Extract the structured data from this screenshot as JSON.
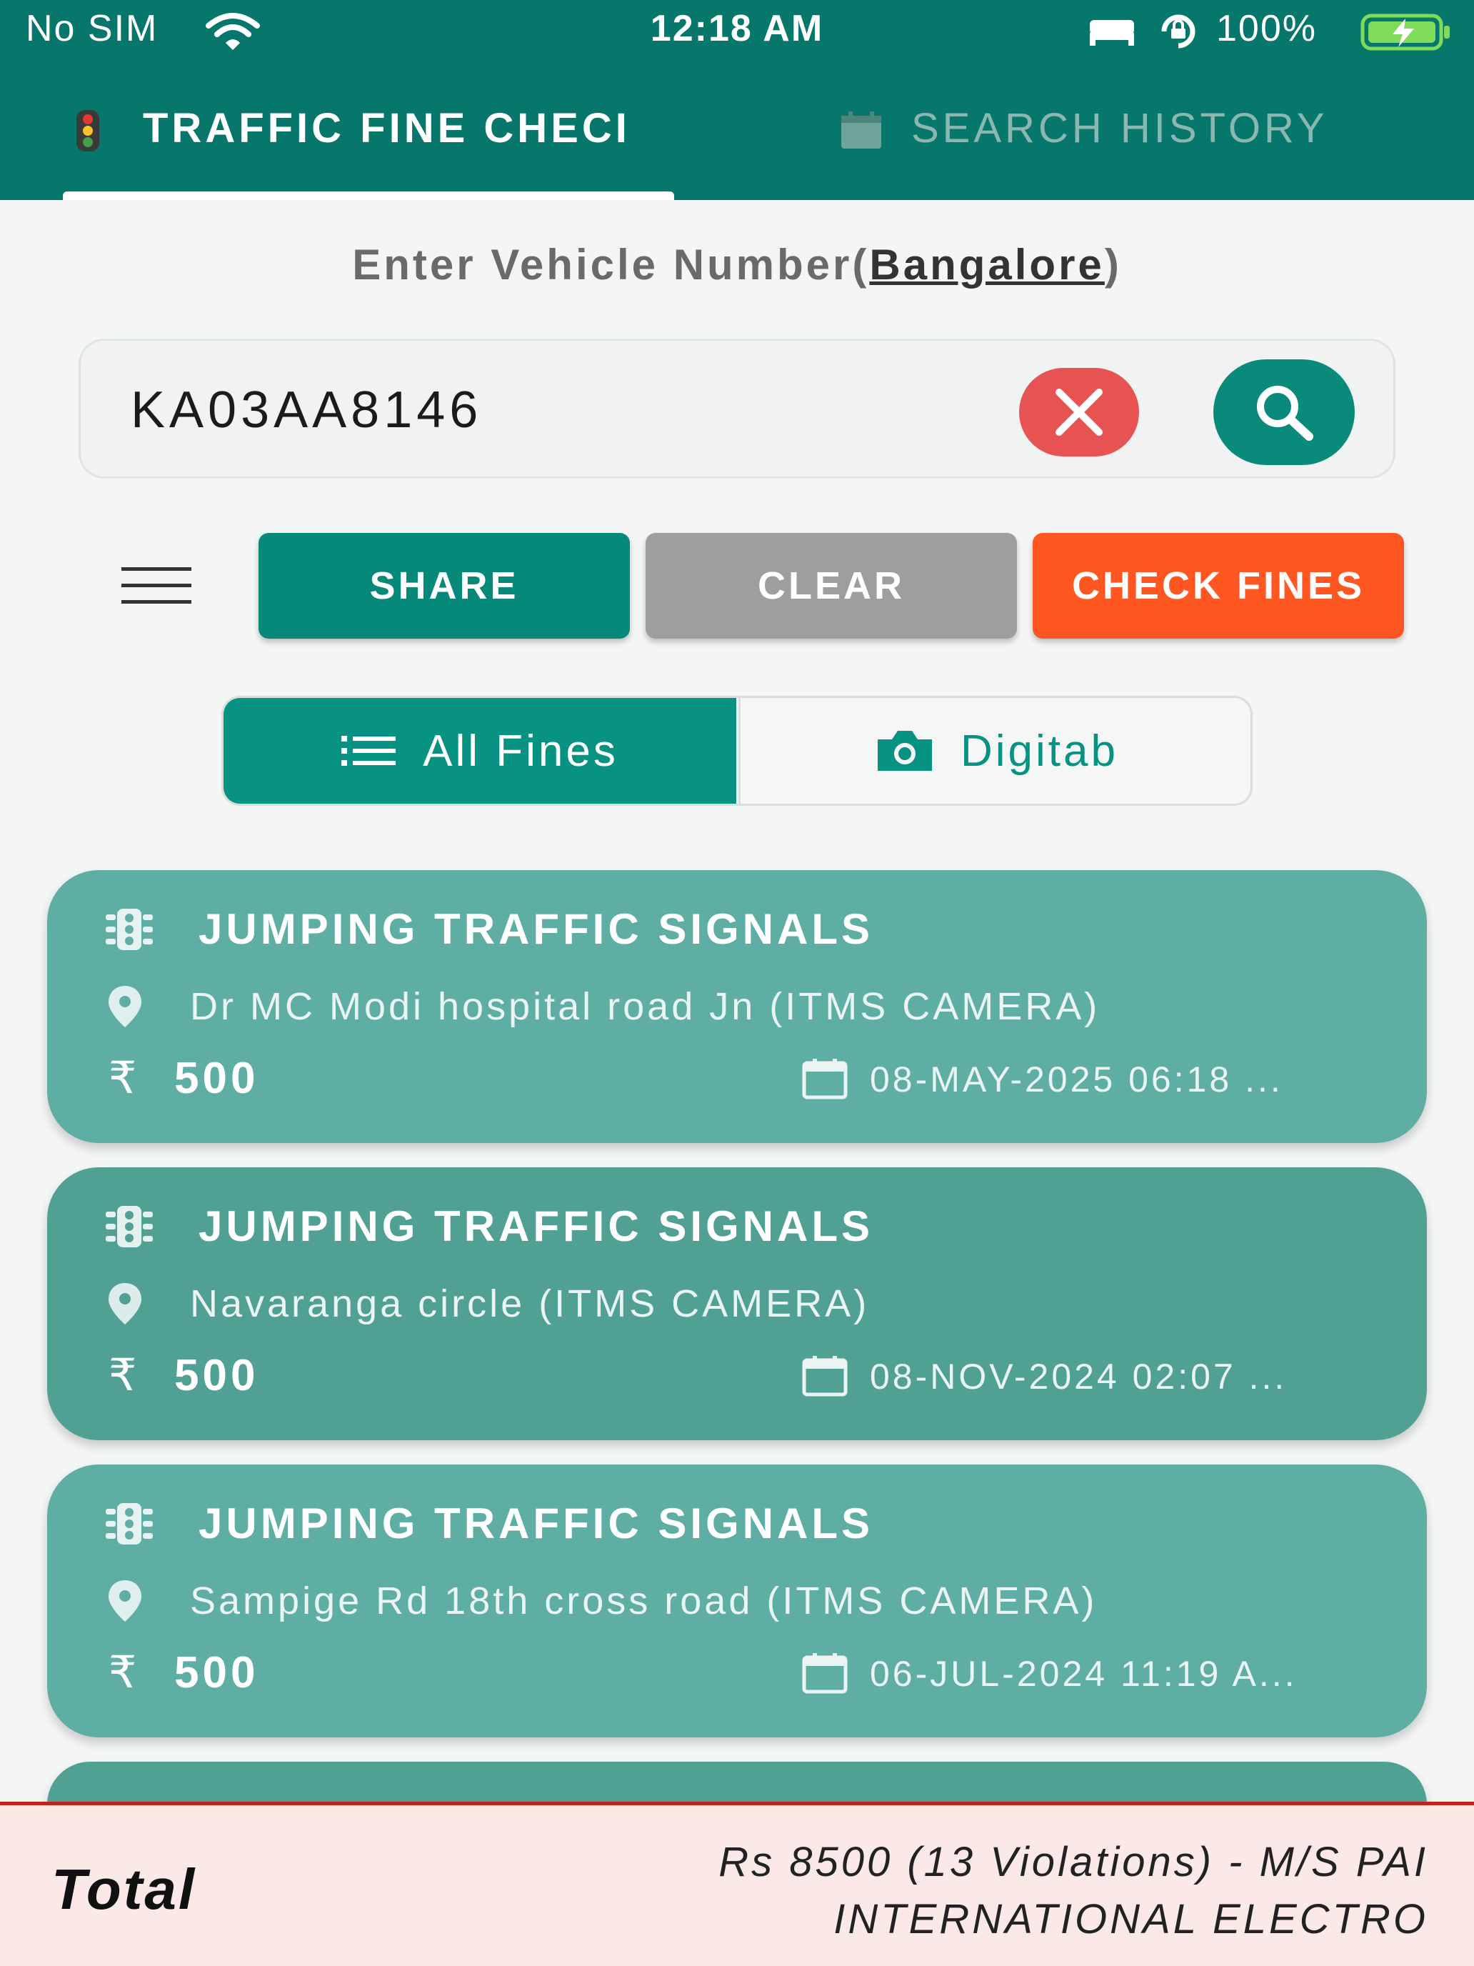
{
  "status_bar": {
    "carrier": "No SIM",
    "time": "12:18 AM",
    "battery": "100%"
  },
  "tabs": [
    {
      "label": "TRAFFIC FINE CHECI",
      "icon": "traffic-light-icon",
      "active": true
    },
    {
      "label": "SEARCH  HISTORY",
      "icon": "history-icon",
      "active": false
    }
  ],
  "vehicle_label": {
    "prefix": "Enter Vehicle Number(",
    "city": "Bangalore",
    "suffix": ")"
  },
  "search": {
    "value": "KA03AA8146",
    "placeholder": ""
  },
  "actions": {
    "share_label": "SHARE",
    "clear_label": "CLEAR",
    "check_label": "CHECK FINES"
  },
  "segments": {
    "all_label": "All Fines",
    "digitab_label": "Digitab",
    "selected": "All Fines"
  },
  "fines": [
    {
      "title": "JUMPING TRAFFIC SIGNALS",
      "location": "Dr MC Modi hospital road Jn (ITMS CAMERA)",
      "currency": "₹",
      "amount": "500",
      "date": "08-MAY-2025 06:18 ..."
    },
    {
      "title": "JUMPING TRAFFIC SIGNALS",
      "location": "Navaranga circle (ITMS CAMERA)",
      "currency": "₹",
      "amount": "500",
      "date": "08-NOV-2024 02:07 ..."
    },
    {
      "title": "JUMPING TRAFFIC SIGNALS",
      "location": "Sampige Rd 18th cross road (ITMS CAMERA)",
      "currency": "₹",
      "amount": "500",
      "date": "06-JUL-2024 11:19 A..."
    }
  ],
  "footer": {
    "total_label": "Total",
    "total_line1": "Rs 8500 (13 Violations) - M/S PAI",
    "total_line2": "INTERNATIONAL ELECTRO"
  },
  "colors": {
    "header": "#07776b",
    "accent": "#079282",
    "danger": "#e75353",
    "check_fines": "#fe5722",
    "clear": "#9e9e9e"
  }
}
